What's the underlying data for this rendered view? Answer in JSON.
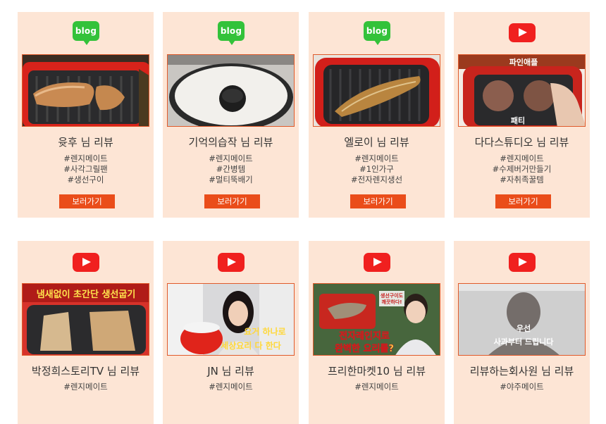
{
  "row1": [
    {
      "source": "blog",
      "badge_text": "blog",
      "title": "윳후 님 리뷰",
      "tags": [
        "#렌지메이트",
        "#사각그릴팬",
        "#생선구이"
      ],
      "button": "보러가기"
    },
    {
      "source": "blog",
      "badge_text": "blog",
      "title": "기억의습작 님 리뷰",
      "tags": [
        "#렌지메이트",
        "#간병템",
        "#멀티뚝배기"
      ],
      "button": "보러가기"
    },
    {
      "source": "blog",
      "badge_text": "blog",
      "title": "엘로이 님 리뷰",
      "tags": [
        "#렌지메이트",
        "#1인가구",
        "#전자렌지생선"
      ],
      "button": "보러가기"
    },
    {
      "source": "youtube",
      "badge_text": "",
      "title": "다다스튜디오 님 리뷰",
      "tags": [
        "#렌지메이트",
        "#수제버거만들기",
        "#자취족꿀템"
      ],
      "button": "보러가기",
      "overlay": [
        "파인애플",
        "패티"
      ]
    }
  ],
  "row2": [
    {
      "source": "youtube",
      "title": "박정희스토리TV 님 리뷰",
      "tags": [
        "#렌지메이트"
      ],
      "overlay": [
        "냄새없이 초간단 생선굽기"
      ]
    },
    {
      "source": "youtube",
      "title": "JN 님 리뷰",
      "tags": [
        "#렌지메이트"
      ],
      "overlay": [
        "요거 하나로",
        "세상요리 다 한다"
      ]
    },
    {
      "source": "youtube",
      "title": "프리한마켓10 님 리뷰",
      "tags": [
        "#렌지메이트"
      ],
      "overlay": [
        "생선구이도",
        "깨끗하다!",
        "전자레인지로",
        "완벽한 요리를?"
      ]
    },
    {
      "source": "youtube",
      "title": "리뷰하는회사원 님 리뷰",
      "tags": [
        "#야주메이트"
      ],
      "overlay": [
        "우선",
        "사과부터 드립니다"
      ]
    }
  ],
  "colors": {
    "card_bg": "#fde5d5",
    "button": "#ea4d1a",
    "blog_green": "#33c23a",
    "youtube_red": "#f0201f"
  }
}
